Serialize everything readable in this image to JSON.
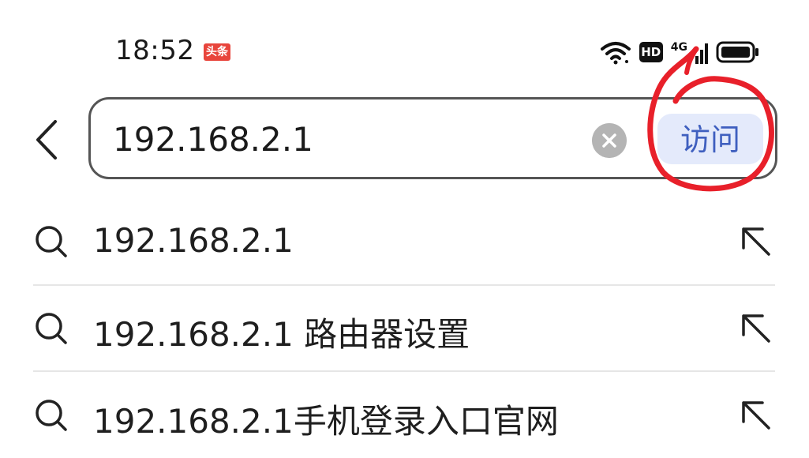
{
  "status_bar": {
    "time": "18:52",
    "news_badge": "头条",
    "hd_label": "HD",
    "network_label": "4G"
  },
  "search": {
    "value": "192.168.2.1",
    "visit_label": "访问"
  },
  "suggestions": [
    {
      "text": "192.168.2.1"
    },
    {
      "text": "192.168.2.1 路由器设置"
    },
    {
      "text": "192.168.2.1手机登录入口官网"
    }
  ],
  "colors": {
    "accent": "#3f5fbf",
    "visit_bg": "#e4eafb",
    "annotation_red": "#e8202a",
    "badge_red": "#e8453c"
  }
}
